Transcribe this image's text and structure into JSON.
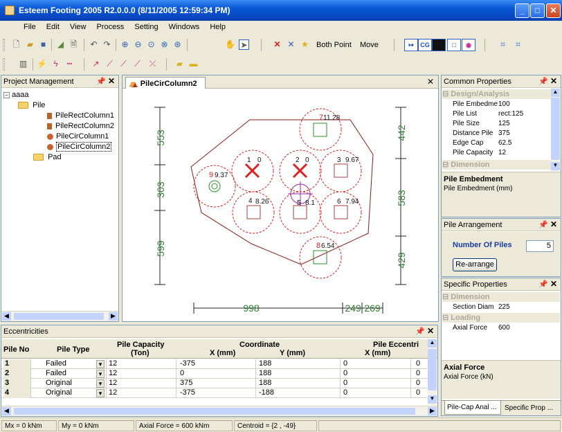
{
  "window": {
    "title": "Esteem Footing 2005 R2.0.0.0 (8/11/2005 12:59:34 PM)"
  },
  "menu": [
    "File",
    "Edit",
    "View",
    "Process",
    "Setting",
    "Windows",
    "Help"
  ],
  "toolbar": {
    "both_point": "Both Point",
    "move": "Move",
    "cg": "CG"
  },
  "project_panel": {
    "title": "Project Management",
    "tree": {
      "root": "aaaa",
      "pile": "Pile",
      "items": [
        "PileRectColumn1",
        "PileRectColumn2",
        "PileCirColumn1",
        "PileCirColumn2"
      ],
      "pad": "Pad"
    }
  },
  "document": {
    "tab": "PileCirColumn2",
    "dims": {
      "left": [
        "553",
        "303",
        "599"
      ],
      "right": [
        "442",
        "583",
        "429"
      ],
      "bottom": [
        "998",
        "249",
        "269"
      ]
    },
    "piles": [
      {
        "id": "1",
        "value": "0"
      },
      {
        "id": "2",
        "value": "0"
      },
      {
        "id": "3",
        "value": "9.67"
      },
      {
        "id": "4",
        "value": "8.26"
      },
      {
        "id": "5",
        "value": "8.1"
      },
      {
        "id": "6",
        "value": "7.94"
      },
      {
        "id": "7",
        "value": "11.28"
      },
      {
        "id": "8",
        "value": "6.54"
      },
      {
        "id": "9",
        "value": "9.37"
      }
    ]
  },
  "common_props": {
    "title": "Common Properties",
    "group1": "Design/Analysis",
    "rows": [
      {
        "k": "Pile Embedme",
        "v": "100"
      },
      {
        "k": "Pile List",
        "v": "rect:125"
      },
      {
        "k": "Pile Size",
        "v": "125"
      },
      {
        "k": "Distance Pile",
        "v": "375"
      },
      {
        "k": "Edge Cap",
        "v": "62.5"
      },
      {
        "k": "Pile Capacity",
        "v": "12"
      }
    ],
    "group2": "Dimension",
    "desc_title": "Pile Embedment",
    "desc": "Pile Embedment (mm)"
  },
  "pile_arrangement": {
    "title": "Pile Arrangement",
    "label": "Number Of Piles",
    "value": "5",
    "button": "Re-arrange"
  },
  "specific_props": {
    "title": "Specific Properties",
    "group1": "Dimension",
    "row1": {
      "k": "Section Diam",
      "v": "225"
    },
    "group2": "Loading",
    "row2": {
      "k": "Axial Force",
      "v": "600"
    },
    "desc_title": "Axial Force",
    "desc": "Axial Force (kN)",
    "tabs": [
      "Pile-Cap Anal ...",
      "Specific Prop ..."
    ]
  },
  "eccentricities": {
    "title": "Eccentricities",
    "headers": {
      "pile_no": "Pile No",
      "pile_type": "Pile Type",
      "capacity": "Pile Capacity",
      "capacity_unit": "(Ton)",
      "coordinate": "Coordinate",
      "x": "X (mm)",
      "y": "Y (mm)",
      "ecc": "Pile Eccentri",
      "ecc_x": "X (mm)"
    },
    "rows": [
      [
        "1",
        "Failed",
        "12",
        "-375",
        "188",
        "0",
        "0"
      ],
      [
        "2",
        "Failed",
        "12",
        "0",
        "188",
        "0",
        "0"
      ],
      [
        "3",
        "Original",
        "12",
        "375",
        "188",
        "0",
        "0"
      ],
      [
        "4",
        "Original",
        "12",
        "-375",
        "-188",
        "0",
        "0"
      ]
    ]
  },
  "status": {
    "mx": "Mx = 0 kNm",
    "my": "My = 0 kNm",
    "axial": "Axial Force = 600 kNm",
    "centroid": "Centroid = {2 , -49}"
  }
}
